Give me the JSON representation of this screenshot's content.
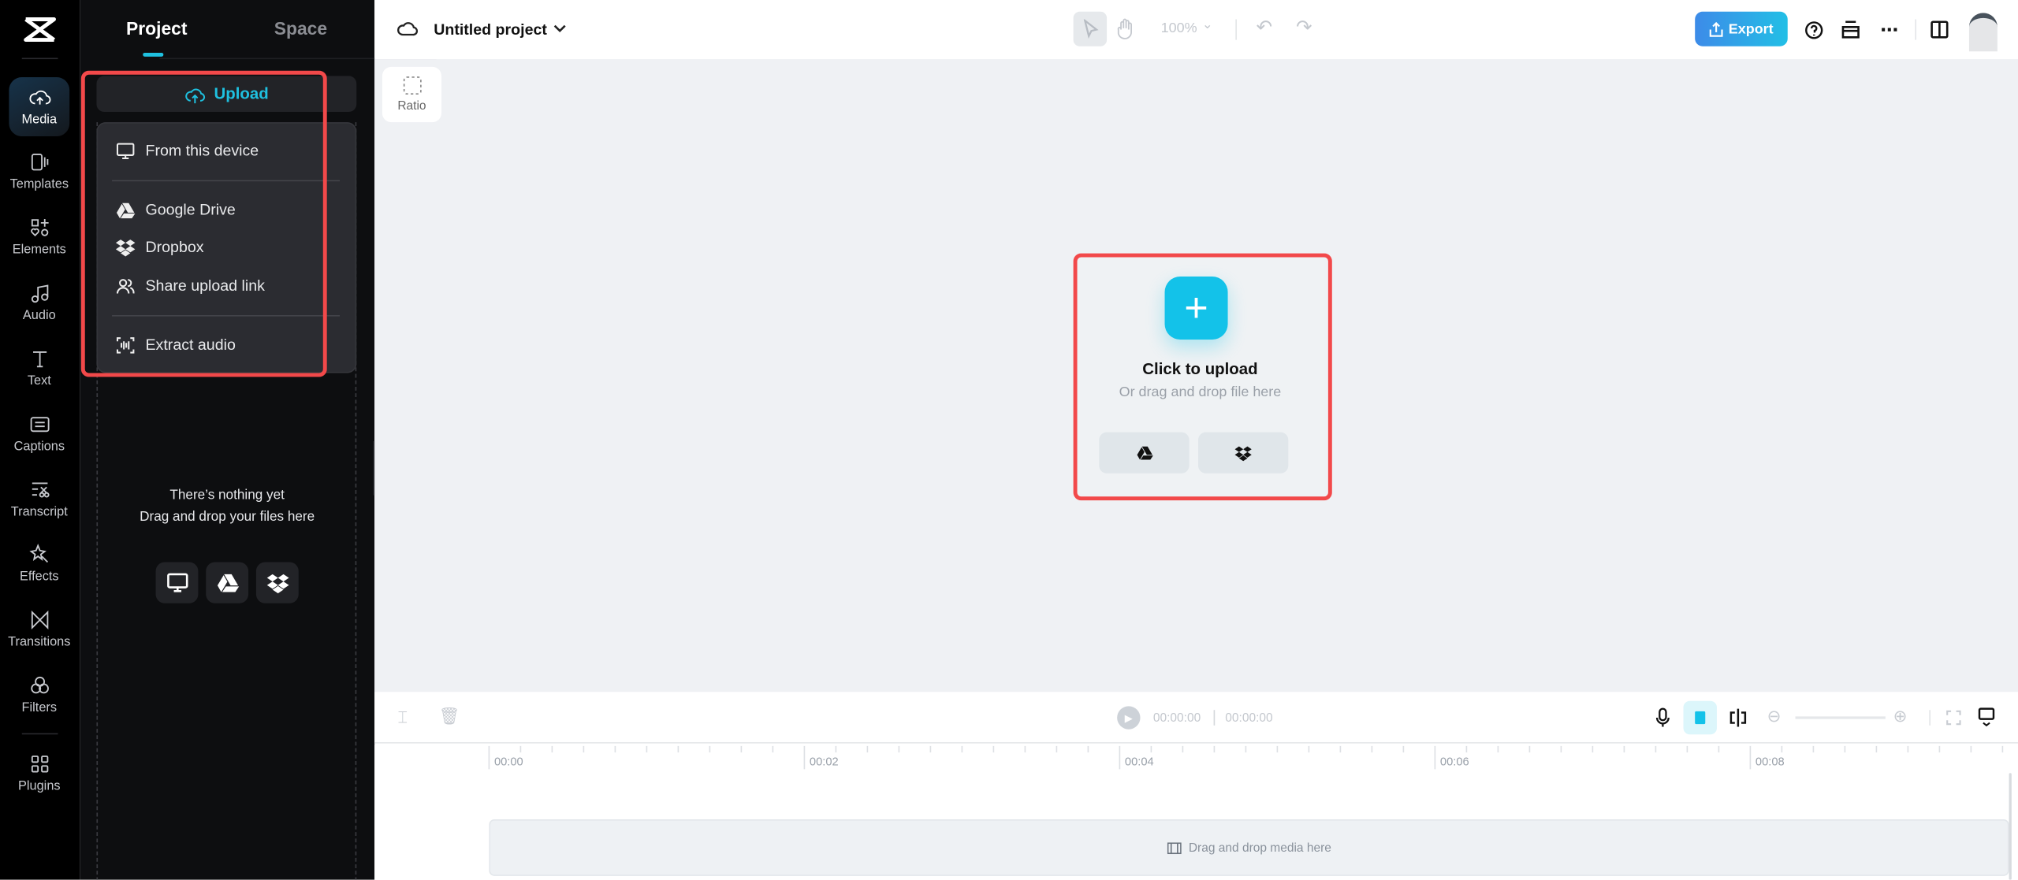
{
  "rail": {
    "items": [
      {
        "label": "Media",
        "icon": "cloud-upload-icon"
      },
      {
        "label": "Templates",
        "icon": "templates-icon"
      },
      {
        "label": "Elements",
        "icon": "elements-icon"
      },
      {
        "label": "Audio",
        "icon": "music-note-icon"
      },
      {
        "label": "Text",
        "icon": "text-icon"
      },
      {
        "label": "Captions",
        "icon": "captions-icon"
      },
      {
        "label": "Transcript",
        "icon": "transcript-icon"
      },
      {
        "label": "Effects",
        "icon": "effects-icon"
      },
      {
        "label": "Transitions",
        "icon": "transitions-icon"
      },
      {
        "label": "Filters",
        "icon": "filters-icon"
      },
      {
        "label": "Plugins",
        "icon": "plugins-icon"
      }
    ],
    "active": "Media"
  },
  "panel": {
    "tabs": [
      {
        "label": "Project"
      },
      {
        "label": "Space"
      }
    ],
    "upload_label": "Upload",
    "menu": [
      {
        "label": "From this device",
        "icon": "monitor-icon"
      },
      {
        "label": "Google Drive",
        "icon": "google-drive-icon"
      },
      {
        "label": "Dropbox",
        "icon": "dropbox-icon"
      },
      {
        "label": "Share upload link",
        "icon": "users-icon"
      },
      {
        "label": "Extract audio",
        "icon": "extract-audio-icon"
      }
    ],
    "empty_title": "There’s nothing yet",
    "empty_subtitle": "Drag and drop your files here"
  },
  "topbar": {
    "project_title": "Untitled project",
    "zoom": "100%",
    "export_label": "Export"
  },
  "canvas": {
    "ratio_label": "Ratio",
    "upload_title": "Click to upload",
    "upload_subtitle": "Or drag and drop file here"
  },
  "timeline": {
    "current_time": "00:00:00",
    "total_time": "00:00:00",
    "ticks": [
      "00:00",
      "00:02",
      "00:04",
      "00:06",
      "00:08"
    ],
    "track_placeholder": "Drag and drop media here"
  },
  "colors": {
    "accent": "#13c2e9",
    "export_start": "#3d8be8",
    "export_end": "#22bfe6",
    "highlight": "#f2494a"
  }
}
